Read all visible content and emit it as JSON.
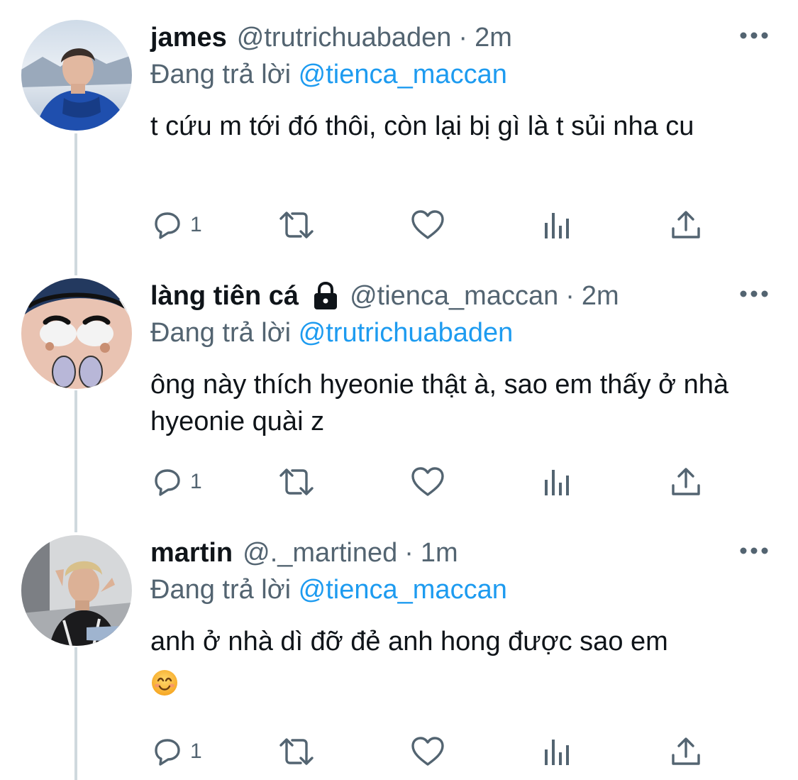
{
  "colors": {
    "text_primary": "#0f1419",
    "text_secondary": "#536471",
    "link_blue": "#1d9bf0",
    "thread_line": "#cfd9de"
  },
  "tweets": [
    {
      "name": "james",
      "handle": "@trutrichuabaden",
      "separator": "·",
      "time": "2m",
      "protected": false,
      "replying_prefix": "Đang trả lời",
      "replying_to": "@tienca_maccan",
      "text": "t cứu m tới đó thôi, còn lại bị gì là t sủi nha cu",
      "emoji": "",
      "reply_count": "1",
      "icons": [
        "avatar",
        "more-icon",
        "reply-icon",
        "retweet-icon",
        "like-icon",
        "analytics-icon",
        "share-icon"
      ]
    },
    {
      "name": "làng tiên cá",
      "handle": "@tienca_maccan",
      "separator": "·",
      "time": "2m",
      "protected": true,
      "replying_prefix": "Đang trả lời",
      "replying_to": "@trutrichuabaden",
      "text": "ông này thích hyeonie thật à, sao em thấy ở nhà hyeonie quài z",
      "emoji": "",
      "reply_count": "1",
      "icons": [
        "avatar",
        "lock-icon",
        "more-icon",
        "reply-icon",
        "retweet-icon",
        "like-icon",
        "analytics-icon",
        "share-icon"
      ]
    },
    {
      "name": "martin",
      "handle": "@._martined",
      "separator": "·",
      "time": "1m",
      "protected": false,
      "replying_prefix": "Đang trả lời",
      "replying_to": "@tienca_maccan",
      "text": "anh ở nhà dì đỡ đẻ anh hong được sao em",
      "emoji": "smiling-face-emoji",
      "reply_count": "1",
      "icons": [
        "avatar",
        "more-icon",
        "reply-icon",
        "retweet-icon",
        "like-icon",
        "analytics-icon",
        "share-icon"
      ]
    }
  ]
}
